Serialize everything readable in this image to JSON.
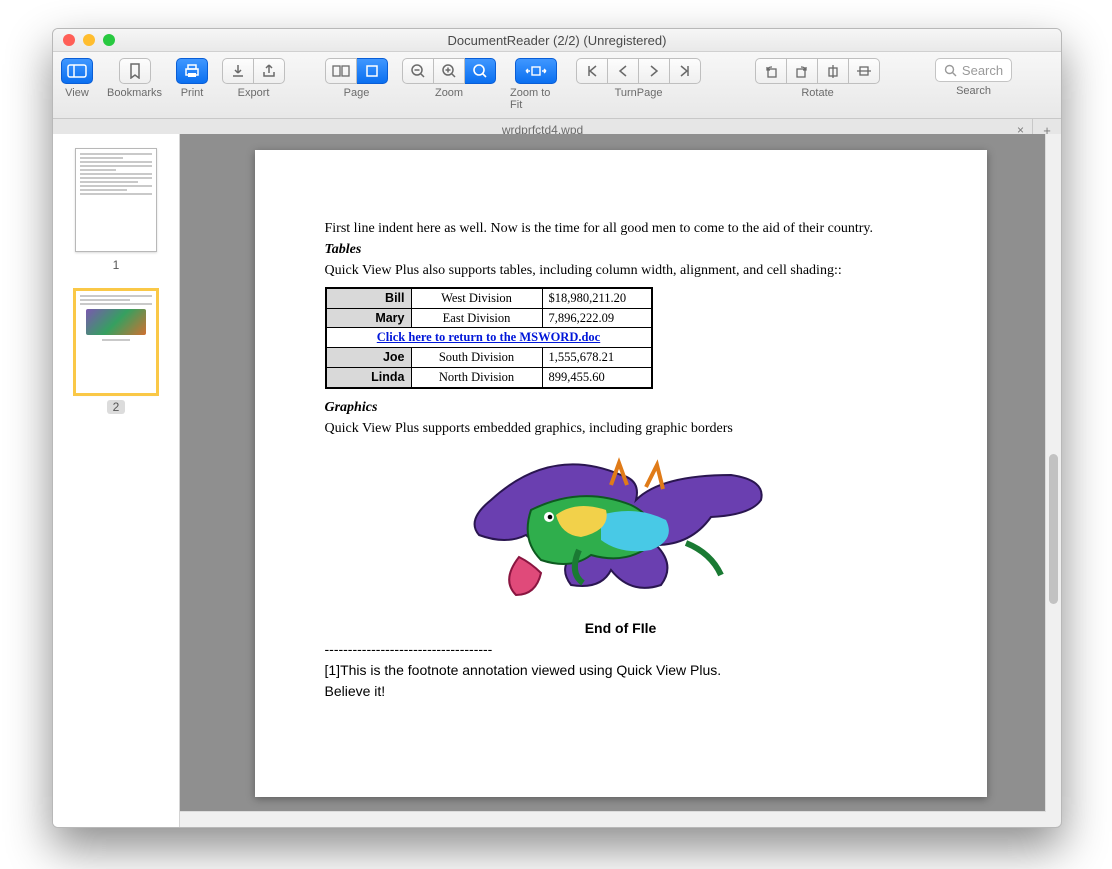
{
  "window": {
    "title": "DocumentReader (2/2) (Unregistered)"
  },
  "traffic": {
    "close": "#ff5f57",
    "min": "#ffbd2e",
    "max": "#28c940"
  },
  "toolbar": {
    "view": "View",
    "bookmarks": "Bookmarks",
    "print": "Print",
    "export": "Export",
    "page": "Page",
    "zoom": "Zoom",
    "zoom_to_fit": "Zoom to Fit",
    "turn_page": "TurnPage",
    "rotate": "Rotate",
    "search_label": "Search",
    "search_placeholder": "Search"
  },
  "tab": {
    "name": "wrdprfctd4.wpd",
    "close": "×",
    "add": "+"
  },
  "thumbs": {
    "p1": "1",
    "p2": "2"
  },
  "doc": {
    "para1": "First line indent here as well.  Now is the time for all good men to come to the aid of their country.",
    "tables_h": "Tables",
    "tables_p": "Quick View Plus also supports tables, including column width, alignment, and cell shading::",
    "rows": [
      {
        "name": "Bill",
        "div": "West Division",
        "amt": "$18,980,211.20"
      },
      {
        "name": "Mary",
        "div": "East Division",
        "amt": "7,896,222.09"
      },
      {
        "name": "Joe",
        "div": "South Division",
        "amt": "1,555,678.21"
      },
      {
        "name": "Linda",
        "div": "North Division",
        "amt": "899,455.60"
      }
    ],
    "link": "Click here to return to the MSWORD.doc",
    "graphics_h": "Graphics",
    "graphics_p": "Quick View Plus supports embedded graphics, including graphic borders",
    "eof": "End of FIle",
    "footsep": "------------------------------------",
    "foot_ref": "[1]",
    "foot1": "This is the footnote annotation viewed using Quick View Plus.",
    "foot2": "Believe it!"
  }
}
